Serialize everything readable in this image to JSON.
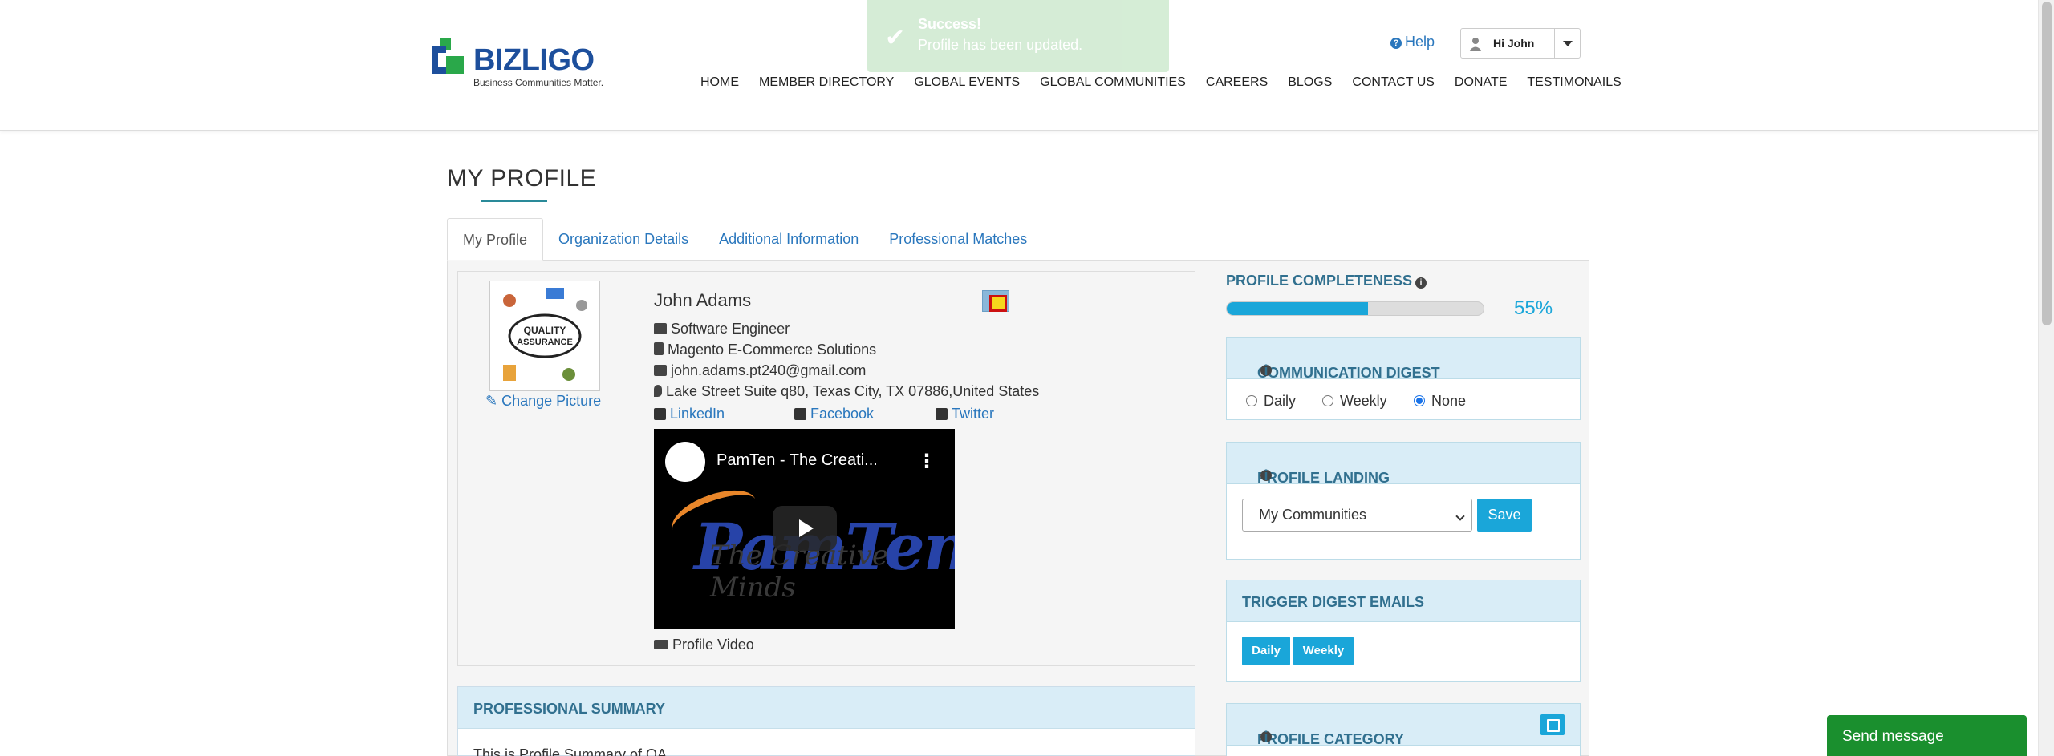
{
  "toast": {
    "title": "Success!",
    "message": "Profile has been updated."
  },
  "header": {
    "logo_text": "BIZLIGO",
    "logo_tagline": "Business Communities Matter.",
    "help": "Help",
    "user_greeting": "Hi John",
    "nav": [
      "HOME",
      "MEMBER DIRECTORY",
      "GLOBAL EVENTS",
      "GLOBAL COMMUNITIES",
      "CAREERS",
      "BLOGS",
      "CONTACT US",
      "DONATE",
      "TESTIMONAILS"
    ]
  },
  "page": {
    "title": "MY PROFILE"
  },
  "tabs": [
    "My Profile",
    "Organization Details",
    "Additional Information",
    "Professional Matches"
  ],
  "profile": {
    "change_picture": "Change Picture",
    "name": "John Adams",
    "job_title": "Software Engineer",
    "company": "Magento E-Commerce Solutions",
    "email": "john.adams.pt240@gmail.com",
    "address": "Lake Street Suite q80, Texas City, TX 07886,United States",
    "social": {
      "linkedin": "LinkedIn",
      "facebook": "Facebook",
      "twitter": "Twitter"
    },
    "video": {
      "title": "PamTen - The Creati...",
      "brand": "PamTen",
      "subtitle": "The Creative Minds",
      "label": "Profile Video"
    }
  },
  "summary": {
    "heading": "PROFESSIONAL SUMMARY",
    "text": "This is Profile Summary of QA"
  },
  "completeness": {
    "heading": "PROFILE COMPLETENESS",
    "percent": 55,
    "label": "55%"
  },
  "digest": {
    "heading": "COMMUNICATION DIGEST",
    "options": [
      "Daily",
      "Weekly",
      "None"
    ],
    "selected": "None"
  },
  "landing": {
    "heading": "PROFILE LANDING",
    "selected": "My Communities",
    "save": "Save"
  },
  "trigger": {
    "heading": "TRIGGER DIGEST EMAILS",
    "daily": "Daily",
    "weekly": "Weekly"
  },
  "category": {
    "heading": "PROFILE CATEGORY"
  },
  "chat": {
    "label": "Send message"
  },
  "colors": {
    "accent": "#1aa6d9",
    "link": "#2a77bd",
    "panel_head": "#d9edf7",
    "panel_text": "#31708f",
    "chat": "#1a8f2e"
  }
}
